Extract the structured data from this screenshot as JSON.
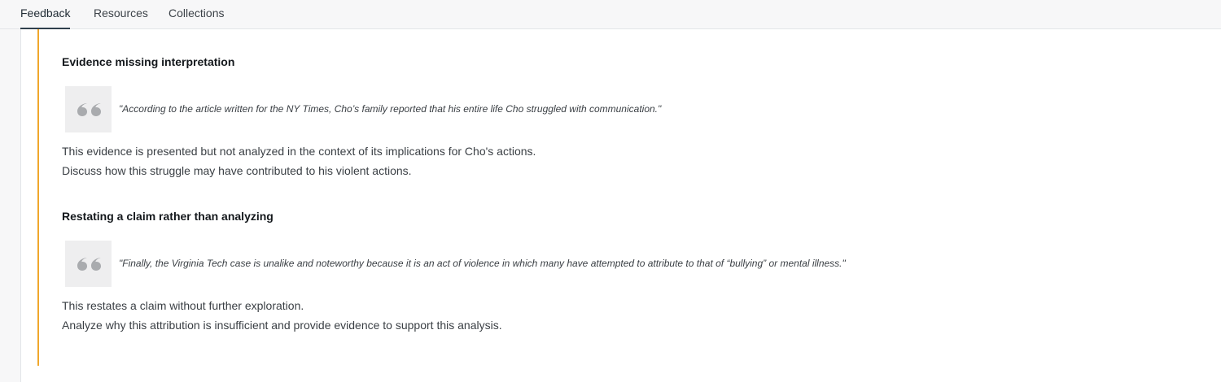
{
  "tabs": [
    {
      "label": "Feedback",
      "active": true
    },
    {
      "label": "Resources",
      "active": false
    },
    {
      "label": "Collections",
      "active": false
    }
  ],
  "accent_color": "#f0a72b",
  "feedback_items": [
    {
      "title": "Evidence missing interpretation",
      "quote_icon": "quote-icon",
      "quote": "\"According to the article written for the NY Times, Cho’s family reported that his entire life Cho struggled with communication.\"",
      "comments": [
        "This evidence is presented but not analyzed in the context of its implications for Cho's actions.",
        "Discuss how this struggle may have contributed to his violent actions."
      ]
    },
    {
      "title": "Restating a claim rather than analyzing",
      "quote_icon": "quote-icon",
      "quote": "\"Finally, the Virginia Tech case is unalike and noteworthy because it is an act of violence in which many have attempted to attribute to that of “bullying” or mental illness.\"",
      "comments": [
        "This restates a claim without further exploration.",
        "Analyze why this attribution is insufficient and provide evidence to support this analysis."
      ]
    }
  ]
}
